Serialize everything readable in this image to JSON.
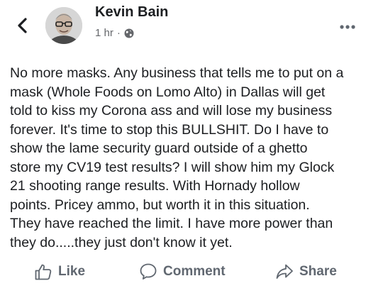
{
  "post": {
    "author": "Kevin Bain",
    "time": "1 hr",
    "separator": "·",
    "privacy_icon": "globe-icon",
    "text": "No more masks. Any business that tells me to put on a\nmask (Whole Foods on Lomo Alto) in Dallas will get\ntold to kiss my Corona ass and will lose my business\nforever. It's time to stop this BULLSHIT. Do I have to\nshow the lame security guard outside of a ghetto\nstore my CV19 test results? I will show him my Glock\n21 shooting range results. With Hornady hollow\npoints. Pricey ammo, but worth it in this situation.\nThey have reached the limit. I have more power than\nthey do.....they just don't know it yet."
  },
  "actions": {
    "like": "Like",
    "comment": "Comment",
    "share": "Share"
  },
  "icons": [
    "back-icon",
    "more-icon",
    "globe-icon",
    "like-icon",
    "comment-icon",
    "share-icon"
  ],
  "colors": {
    "text": "#1c1e21",
    "meta": "#65676b",
    "action": "#606770"
  }
}
